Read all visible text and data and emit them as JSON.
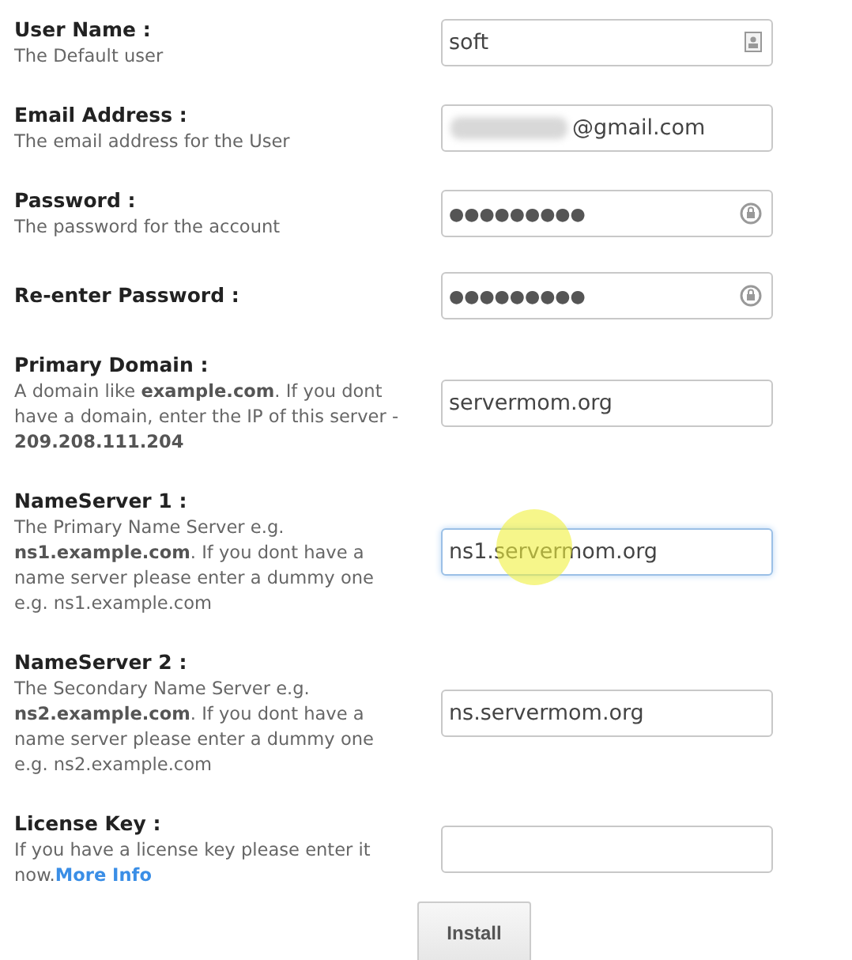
{
  "fields": [
    {
      "label": "User Name :",
      "description": "The Default user",
      "kind": "username",
      "value": "soft",
      "focused": false
    },
    {
      "label": "Email Address :",
      "description": "The email address for the User",
      "kind": "email",
      "value": "@gmail.com",
      "redacted": true,
      "focused": false
    },
    {
      "label": "Password :",
      "description": "The password for the account",
      "kind": "password",
      "value": "●●●●●●●●●",
      "focused": false
    },
    {
      "label": "Re-enter Password :",
      "kind": "password",
      "value": "●●●●●●●●●",
      "focused": false
    },
    {
      "label": "Primary Domain :",
      "description": "A domain like **example.com**. If you dont have a domain, enter the IP of this server - **209.208.111.204**",
      "kind": "text",
      "value": "servermom.org",
      "focused": false
    },
    {
      "label": "NameServer 1 :",
      "description": "The Primary Name Server e.g. **ns1.example.com**. If you dont have a name server please enter a dummy one e.g. ns1.example.com",
      "kind": "text",
      "value": "ns1.servermom.org",
      "focused": true,
      "pointer": true
    },
    {
      "label": "NameServer 2 :",
      "description": "The Secondary Name Server e.g. **ns2.example.com**. If you dont have a name server please enter a dummy one e.g. ns2.example.com",
      "kind": "text",
      "value": "ns.servermom.org",
      "focused": false
    },
    {
      "label": "License Key :",
      "description": "If you have a license key please enter it now.",
      "link": "More Info",
      "kind": "text",
      "focused": false
    }
  ],
  "button": "Install"
}
